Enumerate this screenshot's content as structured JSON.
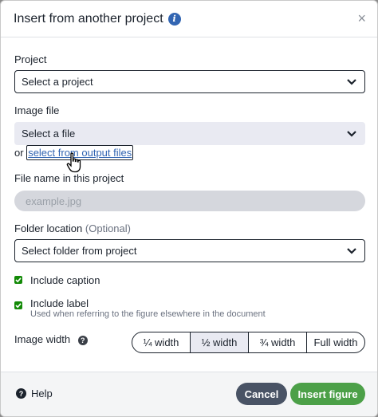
{
  "modal": {
    "title": "Insert from another project",
    "info_icon": "info-icon",
    "close_icon": "close-icon",
    "close_glyph": "×"
  },
  "project": {
    "label": "Project",
    "selected": "Select a project"
  },
  "image_file": {
    "label": "Image file",
    "selected": "Select a file",
    "or_text": "or",
    "output_link": "select from output files"
  },
  "file_name": {
    "label": "File name in this project",
    "placeholder": "example.jpg"
  },
  "folder": {
    "label": "Folder location",
    "optional": "(Optional)",
    "selected": "Select folder from project"
  },
  "include_caption": {
    "label": "Include caption",
    "checked": true
  },
  "include_label": {
    "label": "Include label",
    "help": "Used when referring to the figure elsewhere in the document",
    "checked": true
  },
  "image_width": {
    "label": "Image width",
    "help_icon": "question-icon",
    "options": [
      "¼ width",
      "½ width",
      "¾ width",
      "Full width"
    ],
    "selected": "½ width"
  },
  "footer": {
    "help": "Help",
    "cancel": "Cancel",
    "insert": "Insert figure"
  },
  "colors": {
    "accent": "#3265b2",
    "primary_button": "#4ca048",
    "secondary_button": "#495365",
    "checkbox": "#138a07"
  }
}
